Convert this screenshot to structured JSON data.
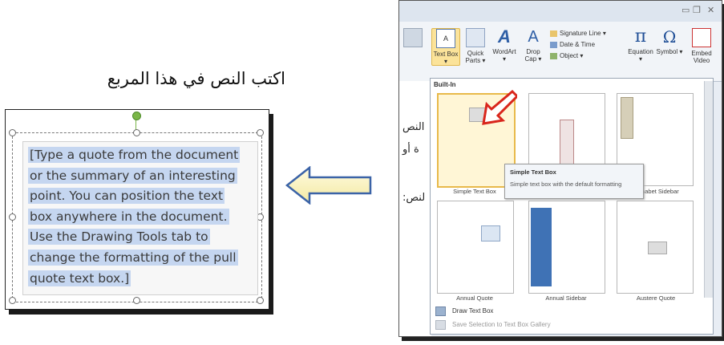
{
  "caption": "اكتب النص في هذا المربع",
  "textbox": {
    "lines": [
      "[Type a quote from the document",
      "or the summary of an interesting",
      "point. You can position the text",
      "box anywhere in the document.",
      "Use the Drawing Tools tab to",
      "change the formatting of the pull",
      "quote text box.]"
    ]
  },
  "ribbon": {
    "text_box": "Text Box ▾",
    "quick_parts": "Quick Parts ▾",
    "wordart": "WordArt ▾",
    "drop_cap": "Drop Cap ▾",
    "signature_line": "Signature Line ▾",
    "date_time": "Date & Time",
    "object": "Object ▾",
    "equation": "Equation ▾",
    "symbol": "Symbol ▾",
    "embed_video": "Embed Video",
    "equation_glyph": "π",
    "symbol_glyph": "Ω"
  },
  "gallery": {
    "heading": "Built-In",
    "tiles": [
      "Simple Text Box",
      "",
      "Alphabet Sidebar",
      "Annual Quote",
      "Annual Sidebar",
      "Austere Quote"
    ],
    "tooltip_title": "Simple Text Box",
    "tooltip_body": "Simple text box with the default formatting"
  },
  "menu": {
    "draw": "Draw Text Box",
    "save": "Save Selection to Text Box Gallery"
  },
  "doc_fragments": [
    "النص",
    "ة أو",
    "لنص:"
  ],
  "colors": {
    "selection": "#c5d6f0",
    "arrow_fill": "#fdf7c4",
    "arrow_stroke": "#3b63a7",
    "rotate_handle": "#7ab648",
    "highlight": "#fbe39a",
    "red_arrow": "#d9261c"
  }
}
